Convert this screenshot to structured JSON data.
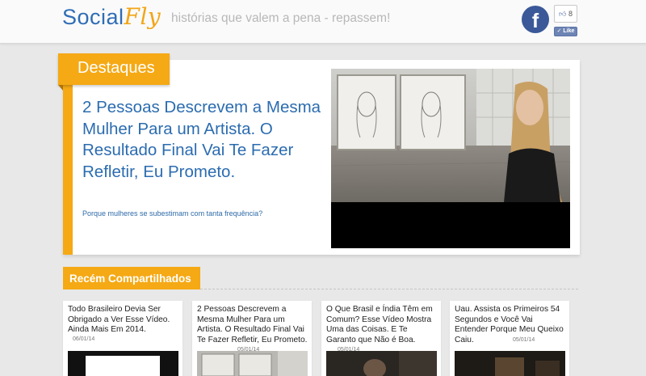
{
  "header": {
    "logo_part1": "Social",
    "logo_part2": "Fly",
    "tagline": "histórias que valem a pena - repassem!",
    "facebook_icon": "facebook-icon",
    "like_count": "8",
    "like_label": "Like"
  },
  "featured": {
    "section_label": "Destaques",
    "title": "2 Pessoas Descrevem a Mesma Mulher Para um Artista. O Resultado Final Vai Te Fazer Refletir, Eu Prometo.",
    "subtitle": "Porque mulheres se subestimam com tanta frequência?"
  },
  "recent": {
    "section_label": "Recém Compartilhados",
    "cards": [
      {
        "title": "Todo Brasileiro Devia Ser Obrigado a Ver Esse Vídeo. Ainda Mais Em 2014.",
        "date": "06/01/14"
      },
      {
        "title": "2 Pessoas Descrevem a Mesma Mulher Para um Artista. O Resultado Final Vai Te Fazer Refletir, Eu Prometo.",
        "date": "05/01/14"
      },
      {
        "title": "O Que Brasil e Índia Têm em Comum? Esse Vídeo Mostra Uma das Coisas. E Te Garanto que Não é Boa.",
        "date": "05/01/14"
      },
      {
        "title": "Uau. Assista os Primeiros 54 Segundos e Você Vai Entender Porque Meu Queixo Caiu.",
        "date": "05/01/14"
      }
    ]
  },
  "colors": {
    "accent": "#f5a914",
    "link_blue": "#2b6cb0",
    "facebook": "#3b5998"
  }
}
